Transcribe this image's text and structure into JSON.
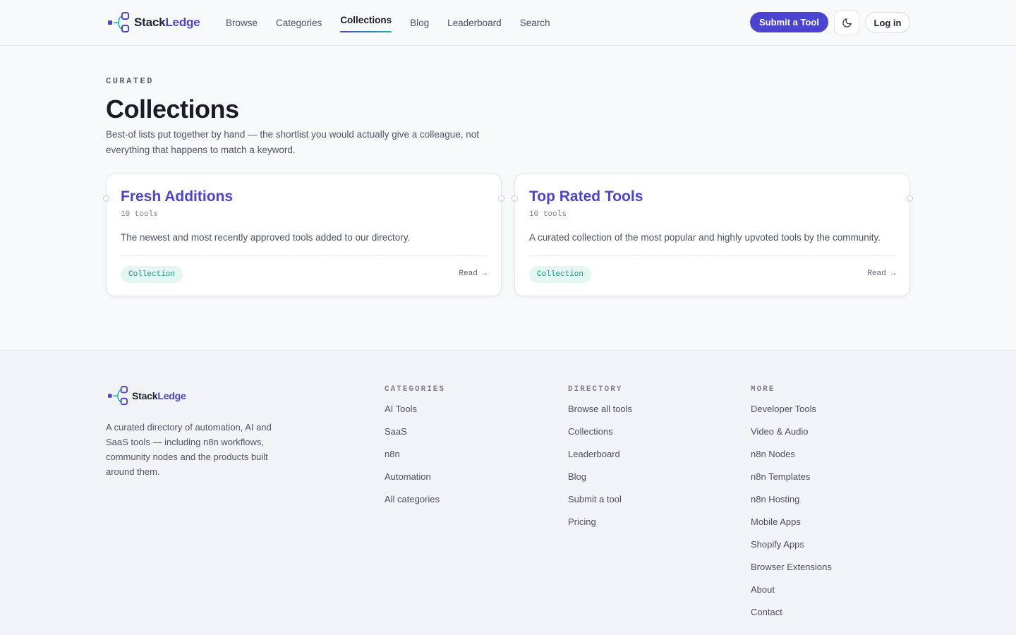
{
  "header": {
    "logo": {
      "part1": "Stack",
      "part2": "Ledge"
    },
    "nav": [
      {
        "label": "Browse"
      },
      {
        "label": "Categories"
      },
      {
        "label": "Collections",
        "active": true
      },
      {
        "label": "Blog"
      },
      {
        "label": "Leaderboard"
      },
      {
        "label": "Search"
      }
    ],
    "submit_label": "Submit a Tool",
    "theme_icon": "moon-icon",
    "login_label": "Log in"
  },
  "hero": {
    "eyebrow": "CURATED",
    "title": "Collections",
    "description": "Best-of lists put together by hand — the shortlist you would actually give a colleague, not everything that happens to match a keyword."
  },
  "collections": [
    {
      "title": "Fresh Additions",
      "count": "10 tools",
      "description": "The newest and most recently approved tools added to our directory.",
      "badge": "Collection",
      "read": "Read →"
    },
    {
      "title": "Top Rated Tools",
      "count": "10 tools",
      "description": "A curated collection of the most popular and highly upvoted tools by the community.",
      "badge": "Collection",
      "read": "Read →"
    }
  ],
  "footer": {
    "logo": {
      "part1": "Stack",
      "part2": "Ledge"
    },
    "about": "A curated directory of automation, AI and SaaS tools — including n8n workflows, community nodes and the products built around them.",
    "columns": [
      {
        "heading": "CATEGORIES",
        "links": [
          "AI Tools",
          "SaaS",
          "n8n",
          "Automation",
          "All categories"
        ]
      },
      {
        "heading": "DIRECTORY",
        "links": [
          "Browse all tools",
          "Collections",
          "Leaderboard",
          "Blog",
          "Submit a tool",
          "Pricing"
        ]
      },
      {
        "heading": "MORE",
        "links": [
          "Developer Tools",
          "Video & Audio",
          "n8n Nodes",
          "n8n Templates",
          "n8n Hosting",
          "Mobile Apps",
          "Shopify Apps",
          "Browser Extensions",
          "About",
          "Contact"
        ]
      }
    ]
  },
  "colors": {
    "brand": "#4b44d0",
    "accent": "#14b8a6",
    "badge_bg": "#e3f6f1"
  }
}
